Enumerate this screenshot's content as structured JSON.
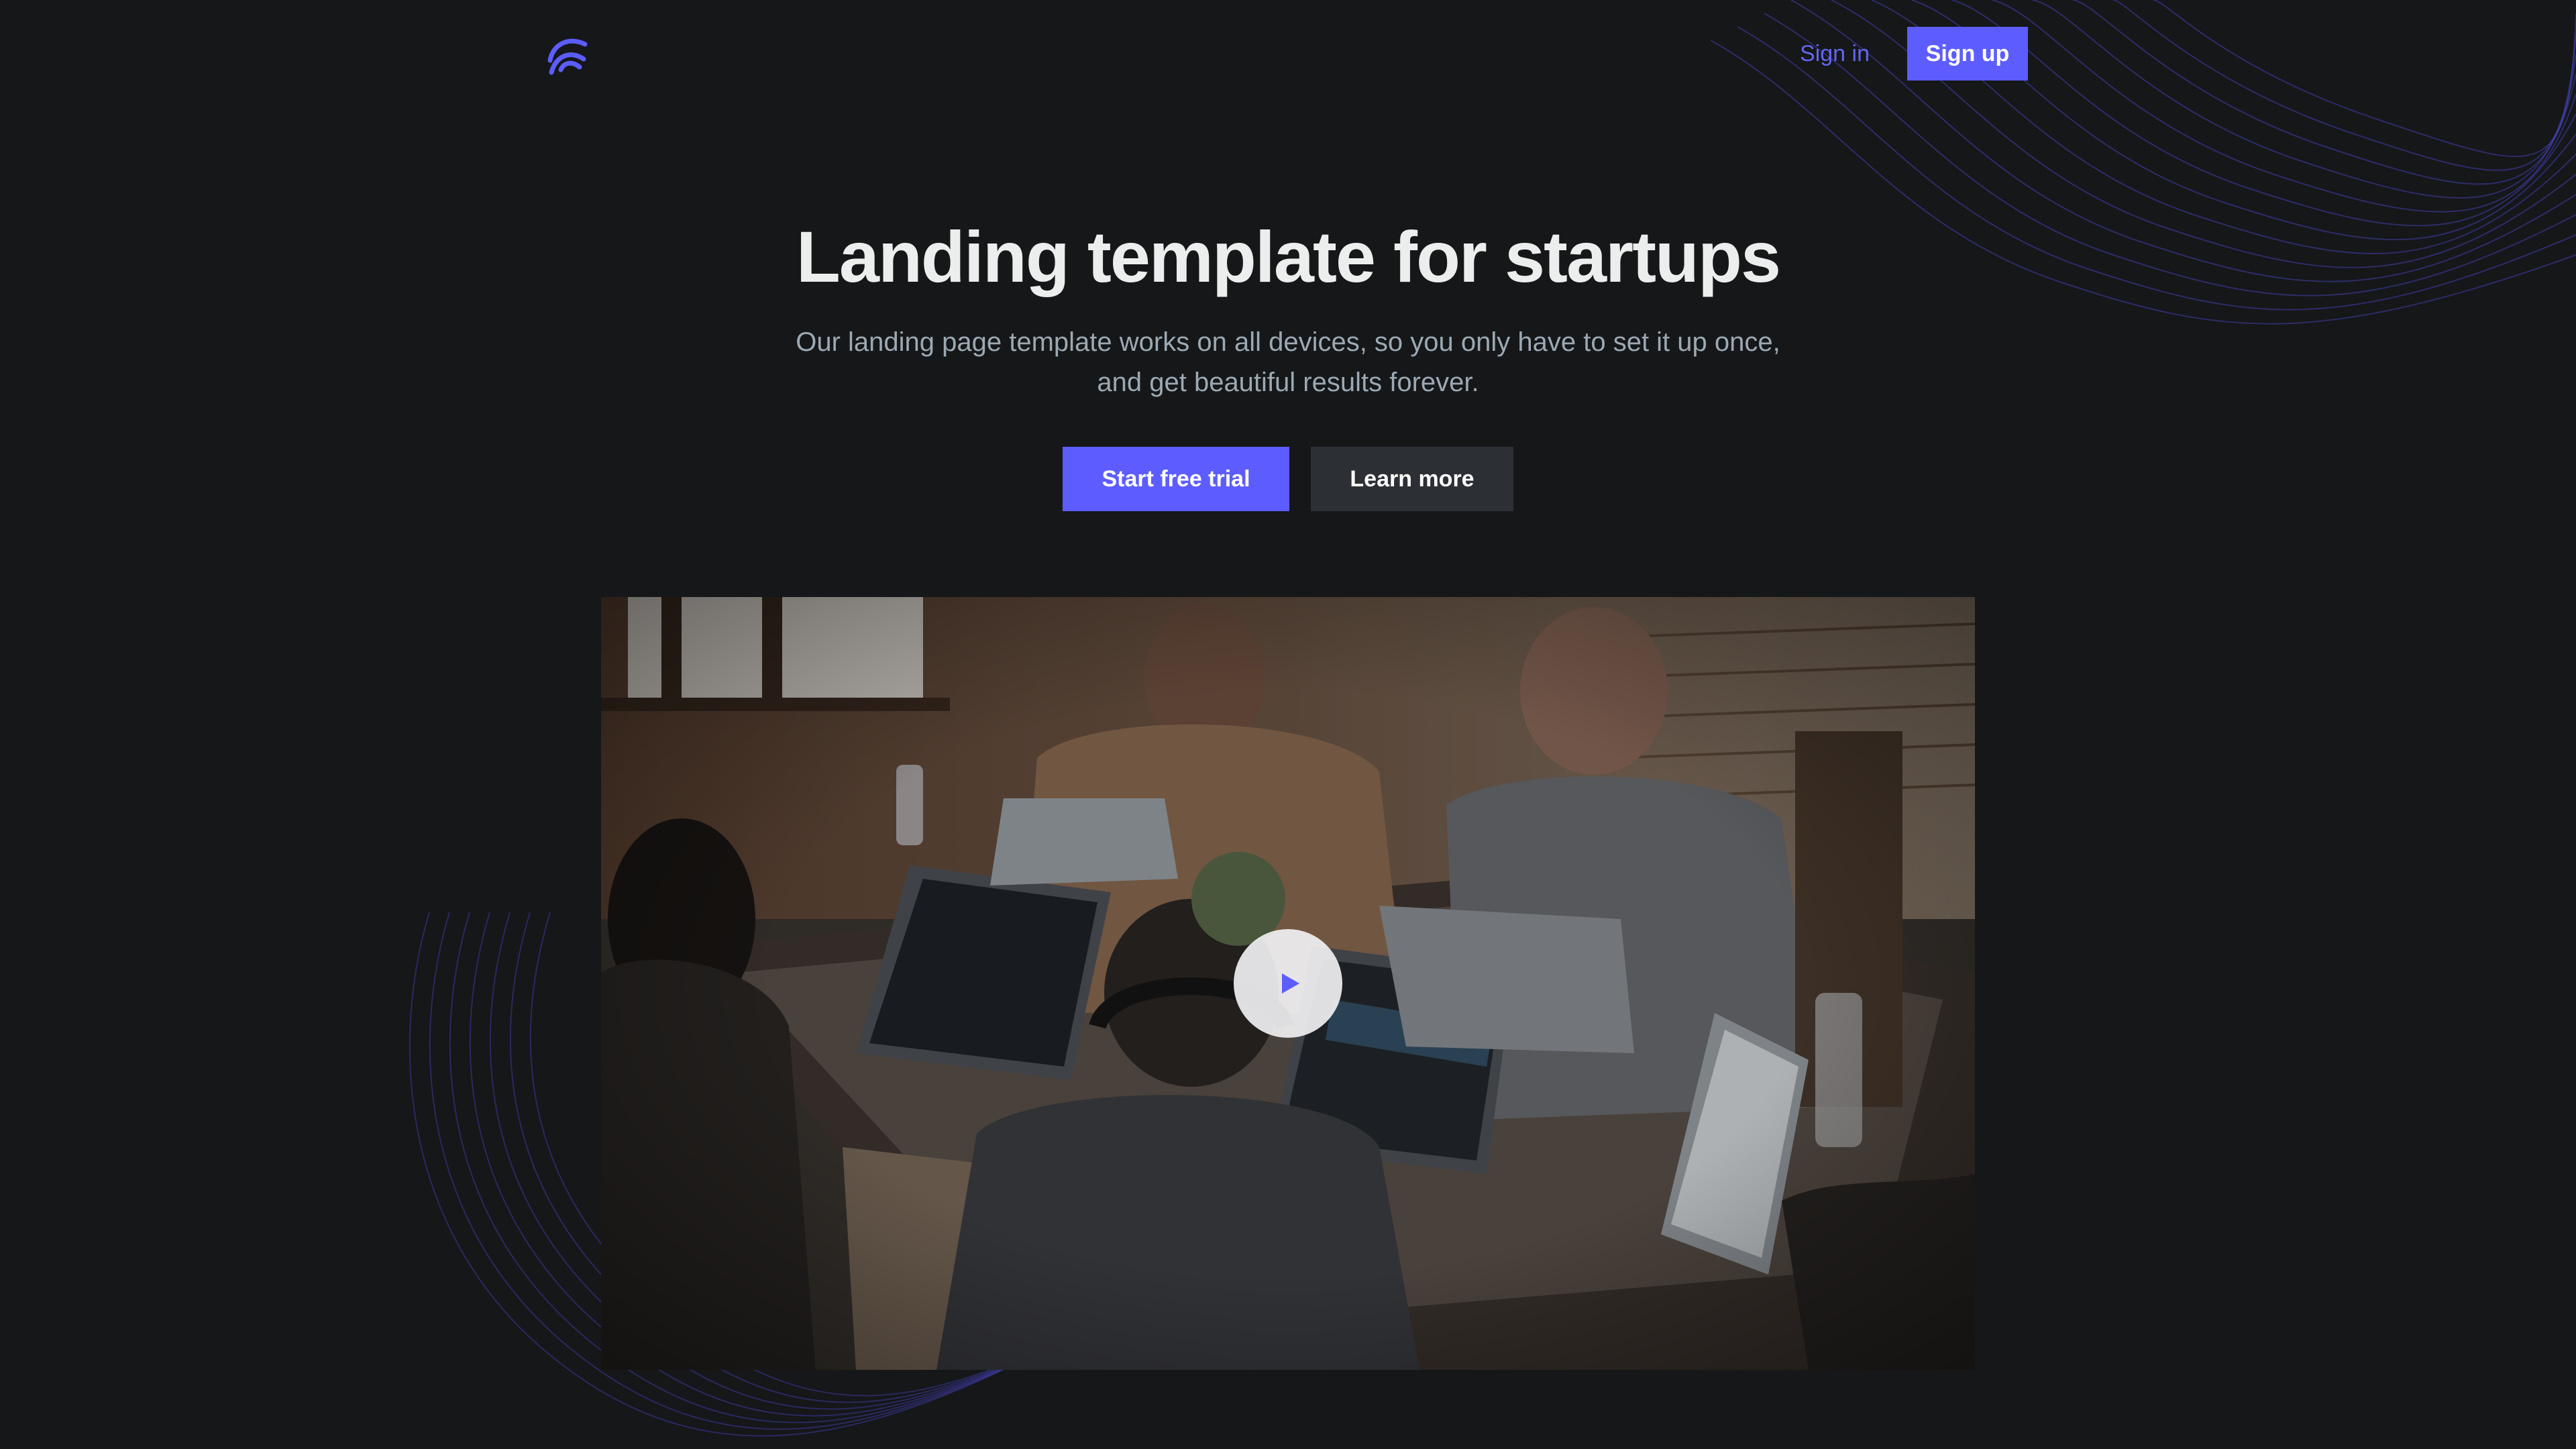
{
  "header": {
    "logo_icon": "brand-logo-icon",
    "signin_label": "Sign in",
    "signup_label": "Sign up"
  },
  "hero": {
    "title": "Landing template for startups",
    "subtitle_line1": "Our landing page template works on all devices, so you only have to set it up once,",
    "subtitle_line2": "and get beautiful results forever.",
    "primary_cta": "Start free trial",
    "secondary_cta": "Learn more"
  },
  "video": {
    "play_icon": "play-icon"
  },
  "colors": {
    "background": "#151719",
    "accent": "#5d5dff",
    "link": "#6366f1",
    "heading": "#eceded",
    "body_text": "#9ca9b3",
    "secondary_button": "#2c2f34"
  }
}
